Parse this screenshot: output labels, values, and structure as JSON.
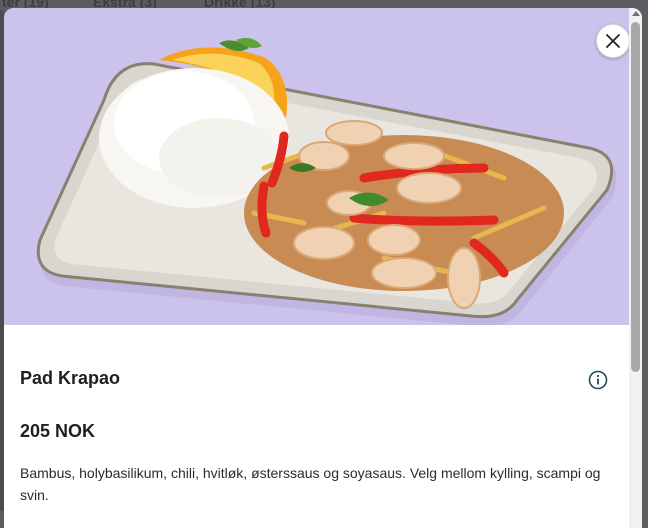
{
  "background_tabs": [
    "ter (19)",
    "Ekstra (3)",
    "Drikke (13)"
  ],
  "product": {
    "title": "Pad Krapao",
    "price": "205 NOK",
    "description": "Bambus, holybasilikum, chili, hvitløk, østerssaus og soyasaus. Velg mellom kylling, scampi og svin."
  },
  "icons": {
    "close": "close-icon",
    "info": "info-icon"
  },
  "colors": {
    "hero_background": "#cbc3ec",
    "text": "#1f1f1f"
  }
}
